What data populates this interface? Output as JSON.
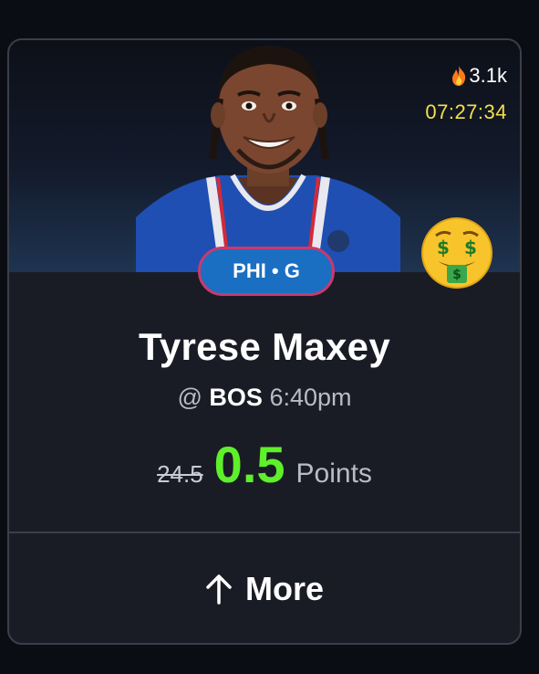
{
  "card": {
    "popularity": "3.1k",
    "timer": "07:27:34",
    "team_position": "PHI • G",
    "player_name": "Tyrese Maxey",
    "matchup_prefix": "@",
    "opponent": "BOS",
    "game_time": "6:40pm",
    "original_line": "24.5",
    "discounted_line": "0.5",
    "stat_type": "Points",
    "more_label": "More"
  },
  "icons": {
    "popularity": "fire-icon",
    "badge": "money-mouth-face-icon",
    "more": "arrow-up-icon"
  },
  "colors": {
    "background": "#0b0d14",
    "card": "#1a1c25",
    "timer": "#f5e04a",
    "discount": "#5ef02a",
    "team_pill": "#1a6fc2",
    "team_pill_border": "#c83a6e"
  }
}
